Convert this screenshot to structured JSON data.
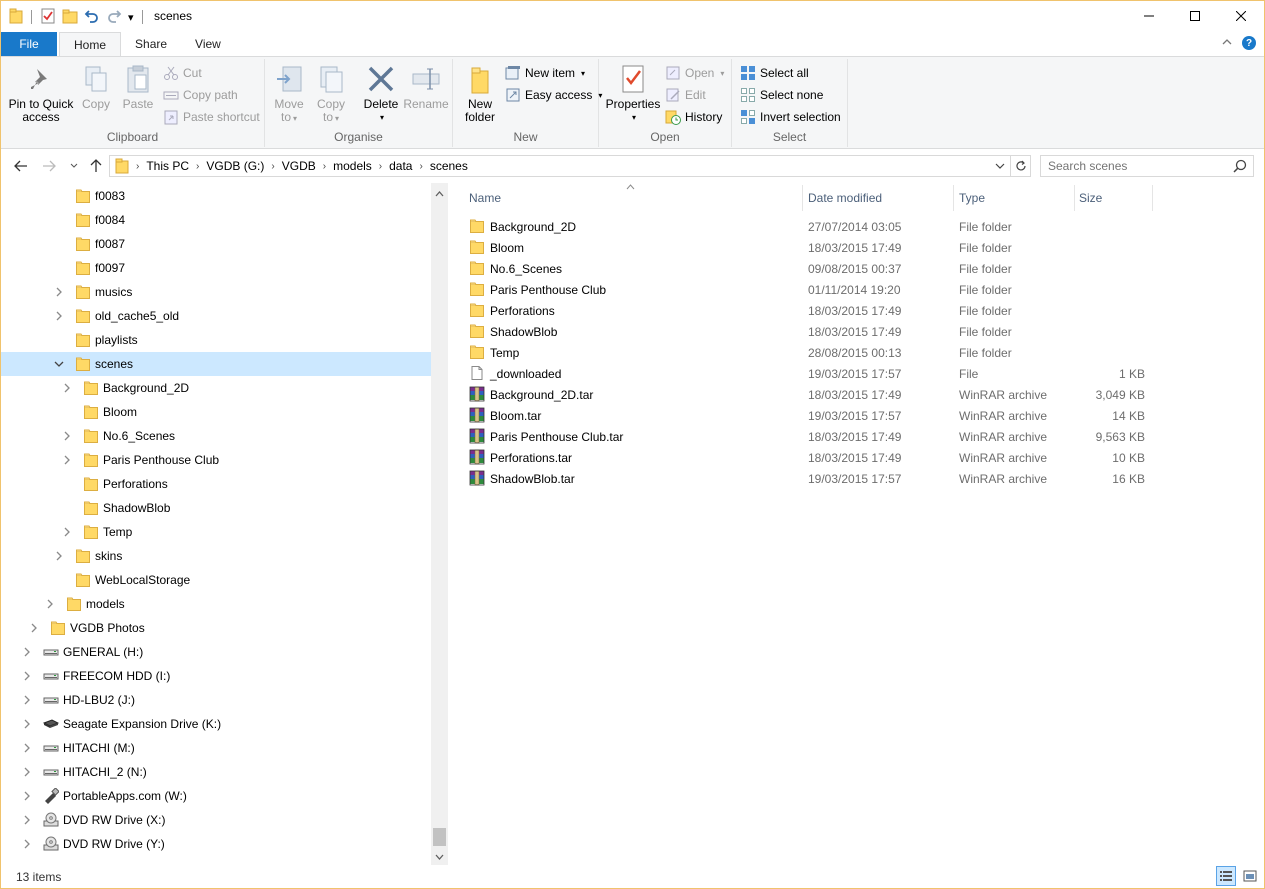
{
  "window": {
    "title": "scenes",
    "qat_dropdown": "▾"
  },
  "tabs": {
    "file": "File",
    "home": "Home",
    "share": "Share",
    "view": "View",
    "help": "?"
  },
  "ribbon": {
    "clipboard": {
      "label": "Clipboard",
      "pin_l1": "Pin to Quick",
      "pin_l2": "access",
      "copy": "Copy",
      "paste": "Paste",
      "cut": "Cut",
      "copy_path": "Copy path",
      "paste_shortcut": "Paste shortcut"
    },
    "organise": {
      "label": "Organise",
      "move_l1": "Move",
      "move_l2": "to",
      "copy_l1": "Copy",
      "copy_l2": "to",
      "delete": "Delete",
      "rename": "Rename"
    },
    "new": {
      "label": "New",
      "folder_l1": "New",
      "folder_l2": "folder",
      "new_item": "New item",
      "easy_access": "Easy access"
    },
    "open": {
      "label": "Open",
      "properties": "Properties",
      "open": "Open",
      "edit": "Edit",
      "history": "History"
    },
    "select": {
      "label": "Select",
      "select_all": "Select all",
      "select_none": "Select none",
      "invert": "Invert selection"
    }
  },
  "address": {
    "crumbs": [
      "This PC",
      "VGDB (G:)",
      "VGDB",
      "models",
      "data",
      "scenes"
    ],
    "search_placeholder": "Search scenes"
  },
  "nav_tree": [
    {
      "label": "f0083",
      "depth": 4,
      "exp": "",
      "icon": "folder",
      "selected": false
    },
    {
      "label": "f0084",
      "depth": 4,
      "exp": "",
      "icon": "folder",
      "selected": false
    },
    {
      "label": "f0087",
      "depth": 4,
      "exp": "",
      "icon": "folder",
      "selected": false
    },
    {
      "label": "f0097",
      "depth": 4,
      "exp": "",
      "icon": "folder",
      "selected": false
    },
    {
      "label": "musics",
      "depth": 4,
      "exp": "collapsed",
      "icon": "folder",
      "selected": false
    },
    {
      "label": "old_cache5_old",
      "depth": 4,
      "exp": "collapsed",
      "icon": "folder",
      "selected": false
    },
    {
      "label": "playlists",
      "depth": 4,
      "exp": "",
      "icon": "folder",
      "selected": false
    },
    {
      "label": "scenes",
      "depth": 4,
      "exp": "expanded",
      "icon": "folder",
      "selected": true
    },
    {
      "label": "Background_2D",
      "depth": 5,
      "exp": "collapsed",
      "icon": "folder",
      "selected": false
    },
    {
      "label": "Bloom",
      "depth": 5,
      "exp": "",
      "icon": "folder",
      "selected": false
    },
    {
      "label": "No.6_Scenes",
      "depth": 5,
      "exp": "collapsed",
      "icon": "folder",
      "selected": false
    },
    {
      "label": "Paris Penthouse Club",
      "depth": 5,
      "exp": "collapsed",
      "icon": "folder",
      "selected": false
    },
    {
      "label": "Perforations",
      "depth": 5,
      "exp": "",
      "icon": "folder",
      "selected": false
    },
    {
      "label": "ShadowBlob",
      "depth": 5,
      "exp": "",
      "icon": "folder",
      "selected": false
    },
    {
      "label": "Temp",
      "depth": 5,
      "exp": "collapsed",
      "icon": "folder",
      "selected": false
    },
    {
      "label": "skins",
      "depth": 4,
      "exp": "collapsed",
      "icon": "folder",
      "selected": false
    },
    {
      "label": "WebLocalStorage",
      "depth": 4,
      "exp": "",
      "icon": "folder",
      "selected": false
    },
    {
      "label": "models",
      "depth": 3,
      "exp": "collapsed",
      "icon": "folder",
      "selected": false
    },
    {
      "label": "VGDB Photos",
      "depth": 2,
      "exp": "collapsed",
      "icon": "folder",
      "selected": false
    },
    {
      "label": "GENERAL (H:)",
      "depth": 1,
      "exp": "collapsed",
      "icon": "drive",
      "selected": false
    },
    {
      "label": "FREECOM HDD (I:)",
      "depth": 1,
      "exp": "collapsed",
      "icon": "drive",
      "selected": false
    },
    {
      "label": "HD-LBU2 (J:)",
      "depth": 1,
      "exp": "collapsed",
      "icon": "drive",
      "selected": false
    },
    {
      "label": "Seagate Expansion Drive (K:)",
      "depth": 1,
      "exp": "collapsed",
      "icon": "extdrive",
      "selected": false
    },
    {
      "label": "HITACHI (M:)",
      "depth": 1,
      "exp": "collapsed",
      "icon": "drive",
      "selected": false
    },
    {
      "label": "HITACHI_2 (N:)",
      "depth": 1,
      "exp": "collapsed",
      "icon": "drive",
      "selected": false
    },
    {
      "label": "PortableApps.com (W:)",
      "depth": 1,
      "exp": "collapsed",
      "icon": "usb",
      "selected": false
    },
    {
      "label": "DVD RW Drive (X:)",
      "depth": 1,
      "exp": "collapsed",
      "icon": "dvd",
      "selected": false
    },
    {
      "label": "DVD RW Drive (Y:)",
      "depth": 1,
      "exp": "collapsed",
      "icon": "dvd",
      "selected": false
    }
  ],
  "columns": {
    "name": "Name",
    "date": "Date modified",
    "type": "Type",
    "size": "Size"
  },
  "files": [
    {
      "name": "Background_2D",
      "date": "27/07/2014 03:05",
      "type": "File folder",
      "size": "",
      "icon": "folder"
    },
    {
      "name": "Bloom",
      "date": "18/03/2015 17:49",
      "type": "File folder",
      "size": "",
      "icon": "folder"
    },
    {
      "name": "No.6_Scenes",
      "date": "09/08/2015 00:37",
      "type": "File folder",
      "size": "",
      "icon": "folder"
    },
    {
      "name": "Paris Penthouse Club",
      "date": "01/11/2014 19:20",
      "type": "File folder",
      "size": "",
      "icon": "folder"
    },
    {
      "name": "Perforations",
      "date": "18/03/2015 17:49",
      "type": "File folder",
      "size": "",
      "icon": "folder"
    },
    {
      "name": "ShadowBlob",
      "date": "18/03/2015 17:49",
      "type": "File folder",
      "size": "",
      "icon": "folder"
    },
    {
      "name": "Temp",
      "date": "28/08/2015 00:13",
      "type": "File folder",
      "size": "",
      "icon": "folder"
    },
    {
      "name": "_downloaded",
      "date": "19/03/2015 17:57",
      "type": "File",
      "size": "1 KB",
      "icon": "file"
    },
    {
      "name": "Background_2D.tar",
      "date": "18/03/2015 17:49",
      "type": "WinRAR archive",
      "size": "3,049 KB",
      "icon": "rar"
    },
    {
      "name": "Bloom.tar",
      "date": "19/03/2015 17:57",
      "type": "WinRAR archive",
      "size": "14 KB",
      "icon": "rar"
    },
    {
      "name": "Paris Penthouse Club.tar",
      "date": "18/03/2015 17:49",
      "type": "WinRAR archive",
      "size": "9,563 KB",
      "icon": "rar"
    },
    {
      "name": "Perforations.tar",
      "date": "18/03/2015 17:49",
      "type": "WinRAR archive",
      "size": "10 KB",
      "icon": "rar"
    },
    {
      "name": "ShadowBlob.tar",
      "date": "19/03/2015 17:57",
      "type": "WinRAR archive",
      "size": "16 KB",
      "icon": "rar"
    }
  ],
  "status": {
    "count": "13 items"
  },
  "colors": {
    "accent": "#1979ca",
    "selection": "#cce8ff",
    "folder": "#ffd966"
  }
}
